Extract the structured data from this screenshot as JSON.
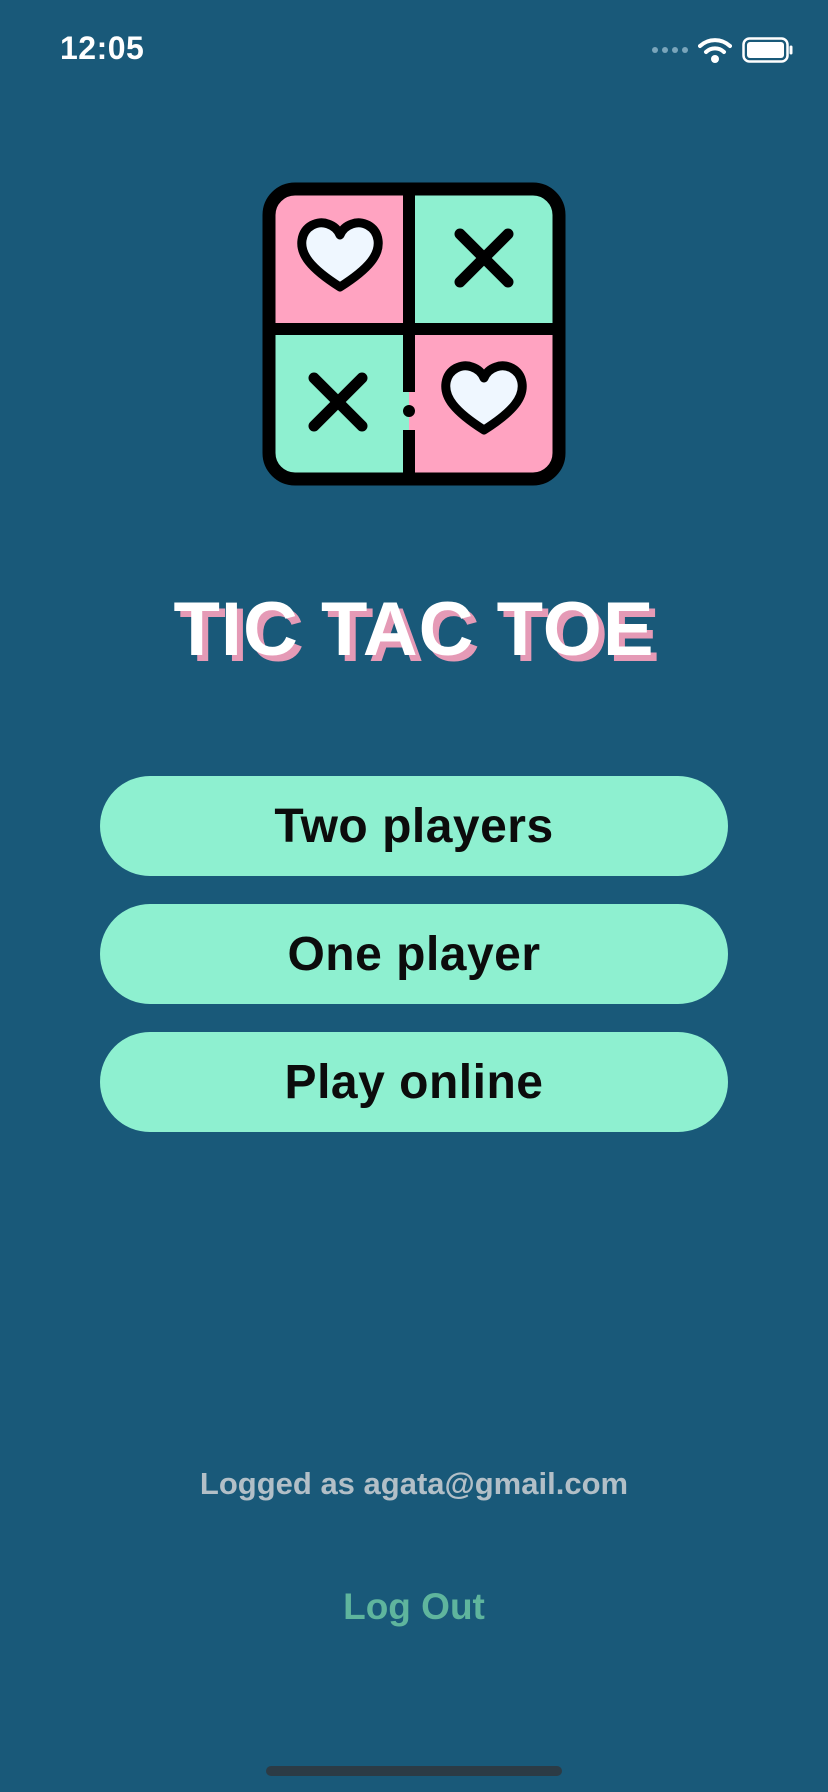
{
  "status_bar": {
    "time": "12:05",
    "icons": [
      "cellular-signal-icon",
      "wifi-icon",
      "battery-icon"
    ]
  },
  "logo": {
    "icon": "tic-tac-toe-heart-cross-icon"
  },
  "title": "TIC TAC TOE",
  "menu": {
    "two_players": "Two players",
    "one_player": "One player",
    "play_online": "Play online"
  },
  "account": {
    "logged_as": "Logged as agata@gmail.com",
    "logout": "Log Out"
  },
  "colors": {
    "background": "#195979",
    "button": "#8ef0d0",
    "pink": "#ffa3c1",
    "mint": "#8ef0d0",
    "title_shadow": "#e59ab6",
    "logout": "#5fb59d"
  }
}
